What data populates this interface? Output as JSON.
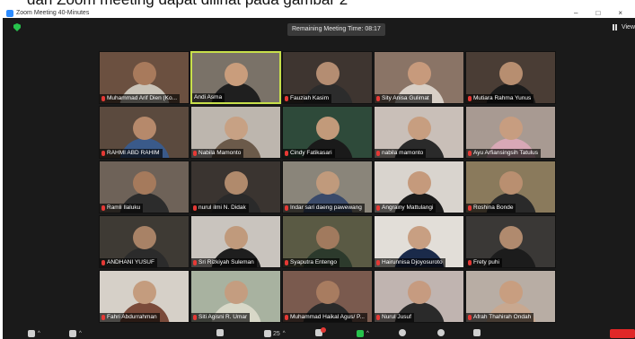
{
  "caption": "dari Zoom meeting dapat dilihat pada gambar 2",
  "window": {
    "title": "Zoom Meeting 40-Minutes",
    "controls": [
      "–",
      "□",
      "×"
    ]
  },
  "topbar": {
    "remaining_time": "Remaining Meeting Time: 08:17",
    "view_label": "View"
  },
  "participants": [
    {
      "name": "Muhammad Arif Dien (Ko...",
      "muted": true,
      "bg": "#6b5040",
      "skin": "#a87a5c",
      "cloth": "#c9c3b8"
    },
    {
      "name": "Andi Asma",
      "muted": false,
      "active": true,
      "bg": "#7a7268",
      "skin": "#c99d7c",
      "cloth": "#1f1f1f"
    },
    {
      "name": "Fauziah Kasim",
      "muted": true,
      "bg": "#3e3530",
      "skin": "#b48d72",
      "cloth": "#2c2c2c"
    },
    {
      "name": "Sity Anisa Gulimat",
      "muted": true,
      "bg": "#8a7466",
      "skin": "#c79a7c",
      "cloth": "#d8cfc6"
    },
    {
      "name": "Mutiara Rahma Yunus",
      "muted": true,
      "bg": "#4a3d35",
      "skin": "#b78e70",
      "cloth": "#1b1b1b"
    },
    {
      "name": "RAHMI ABD RAHIM",
      "muted": true,
      "bg": "#5b4a3e",
      "skin": "#b6896b",
      "cloth": "#3a5a8a"
    },
    {
      "name": "Nabila Mamonto",
      "muted": true,
      "bg": "#bdb6ae",
      "skin": "#c7a184",
      "cloth": "#6b5a4a"
    },
    {
      "name": "Cindy Fatikasari",
      "muted": true,
      "bg": "#2e4a3a",
      "skin": "#c29a7a",
      "cloth": "#1a1a1a"
    },
    {
      "name": "nabila mamonto",
      "muted": true,
      "bg": "#c9bfb8",
      "skin": "#c79e80",
      "cloth": "#2a2a2a"
    },
    {
      "name": "Ayu Arfiansingsih Tatulus",
      "muted": true,
      "bg": "#a89a92",
      "skin": "#c79d80",
      "cloth": "#d8a8b6"
    },
    {
      "name": "Ramli Ilaluku",
      "muted": true,
      "bg": "#6e6258",
      "skin": "#a57a5c",
      "cloth": "#2c2c2c"
    },
    {
      "name": "nurul ilmi N. Didak",
      "muted": true,
      "bg": "#3a3430",
      "skin": "#b08a6c",
      "cloth": "#2a2a2a"
    },
    {
      "name": "Indar sari daeng pawewang",
      "muted": true,
      "bg": "#8a857a",
      "skin": "#c09a7c",
      "cloth": "#3a4a6a"
    },
    {
      "name": "Angrainy Mattulangi",
      "muted": true,
      "bg": "#d9d4ce",
      "skin": "#c59a7c",
      "cloth": "#1a1a1a"
    },
    {
      "name": "Roshina Bonde",
      "muted": true,
      "bg": "#8a7a5c",
      "skin": "#b98f70",
      "cloth": "#2a2a2a"
    },
    {
      "name": "ANDHANI YUSUF",
      "muted": true,
      "bg": "#3e3a34",
      "skin": "#a88266",
      "cloth": "#2b2b2b"
    },
    {
      "name": "Sri Rizkiyah Suleman",
      "muted": true,
      "bg": "#c9c4be",
      "skin": "#c09a7c",
      "cloth": "#1e1e1e"
    },
    {
      "name": "Syaputra Entengo",
      "muted": true,
      "bg": "#5a5a44",
      "skin": "#a17a5e",
      "cloth": "#2c3a2c"
    },
    {
      "name": "Hairunnisa Djoyosuroto",
      "muted": true,
      "bg": "#e2ded8",
      "skin": "#c89f82",
      "cloth": "#1a2a4a"
    },
    {
      "name": "Frety puhi",
      "muted": true,
      "bg": "#3a3836",
      "skin": "#b08a6e",
      "cloth": "#1c1c1c"
    },
    {
      "name": "Fahri Abdurrahman",
      "muted": true,
      "bg": "#d6d0c8",
      "skin": "#c49c7e",
      "cloth": "#7a4a3a"
    },
    {
      "name": "Siti Agisni R. Umar",
      "muted": true,
      "bg": "#a8b2a0",
      "skin": "#c49d80",
      "cloth": "#d8d8c8"
    },
    {
      "name": "Muhammad Haikal Agus/ P...",
      "muted": true,
      "bg": "#7a5a4e",
      "skin": "#a87c60",
      "cloth": "#2a2a2a"
    },
    {
      "name": "Nurul Jusuf",
      "muted": true,
      "bg": "#c0b4b0",
      "skin": "#c69b80",
      "cloth": "#2a2a2a"
    },
    {
      "name": "Afrah Thahirah Ondah",
      "muted": true,
      "bg": "#b8ada4",
      "skin": "#c89e80",
      "cloth": "#c8a890"
    }
  ],
  "toolbar": {
    "participants_count": "25"
  }
}
